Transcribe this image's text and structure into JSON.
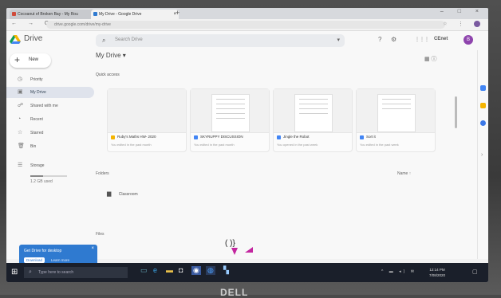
{
  "browser": {
    "tabs": [
      {
        "label": "Cocoanut of Broken Bay - My Rou",
        "color": "#d04a3a"
      },
      {
        "label": "My Drive - Google Drive",
        "color": "#2f7ad0"
      }
    ],
    "new_tab": "+",
    "window_controls": "–  □  ×",
    "nav": "←  →  C  ⌂",
    "url": "drive.google.com/drive/my-drive",
    "right_icons": "☆  ⋮"
  },
  "drive": {
    "title": "Drive",
    "search_placeholder": "Search Drive",
    "search_options": "▾",
    "header_icons": {
      "help": "?",
      "settings": "⚙",
      "apps": "⋮⋮⋮"
    },
    "org_mark": "CEnet",
    "avatar_letter": "B",
    "new_label": "New",
    "nav": [
      {
        "icon": "◷",
        "label": "Priority"
      },
      {
        "icon": "▣",
        "label": "My Drive"
      },
      {
        "icon": "☍",
        "label": "Shared with me"
      },
      {
        "icon": "◔",
        "label": "Recent"
      },
      {
        "icon": "☆",
        "label": "Starred"
      },
      {
        "icon": "🗑",
        "label": "Bin"
      },
      {
        "icon": "☰",
        "label": "Storage"
      }
    ],
    "storage_used": "1.2 GB used",
    "page_title": "My Drive ▾",
    "quick_access": "Quick access",
    "cards": [
      {
        "name": "Ruby's Maths HW- 2020",
        "sub": "You edited in the past month",
        "icon_color": "#f4b400"
      },
      {
        "name": "SKYRUPPY DISCUSSION",
        "sub": "You edited in the past month",
        "icon_color": "#4285f4"
      },
      {
        "name": "Jingle the Robot",
        "sub": "You opened in the past week",
        "icon_color": "#4285f4"
      },
      {
        "name": "Sort it",
        "sub": "You edited in the past week",
        "icon_color": "#4285f4"
      }
    ],
    "folders_label": "Folders",
    "sort_label": "Name ↑",
    "folder_name": "Classroom",
    "files_label": "Files",
    "view_icons": "▦  ⓘ",
    "toast": {
      "title": "Get Drive for desktop",
      "button": "Download",
      "link": "Learn more",
      "close": "×"
    }
  },
  "taskbar": {
    "search_placeholder": "Type here to search",
    "clock_time": "12:14 PM",
    "clock_date": "7/08/2020",
    "tray": "^  ▬  ◂)  ✉"
  },
  "annotations": {
    "pen_mark": "( )}"
  },
  "bezel_logo": "DELL",
  "colors": {
    "drive_blue": "#2f7ad0",
    "taskbar": "#1a1f2a",
    "annotation": "#c3269f"
  }
}
